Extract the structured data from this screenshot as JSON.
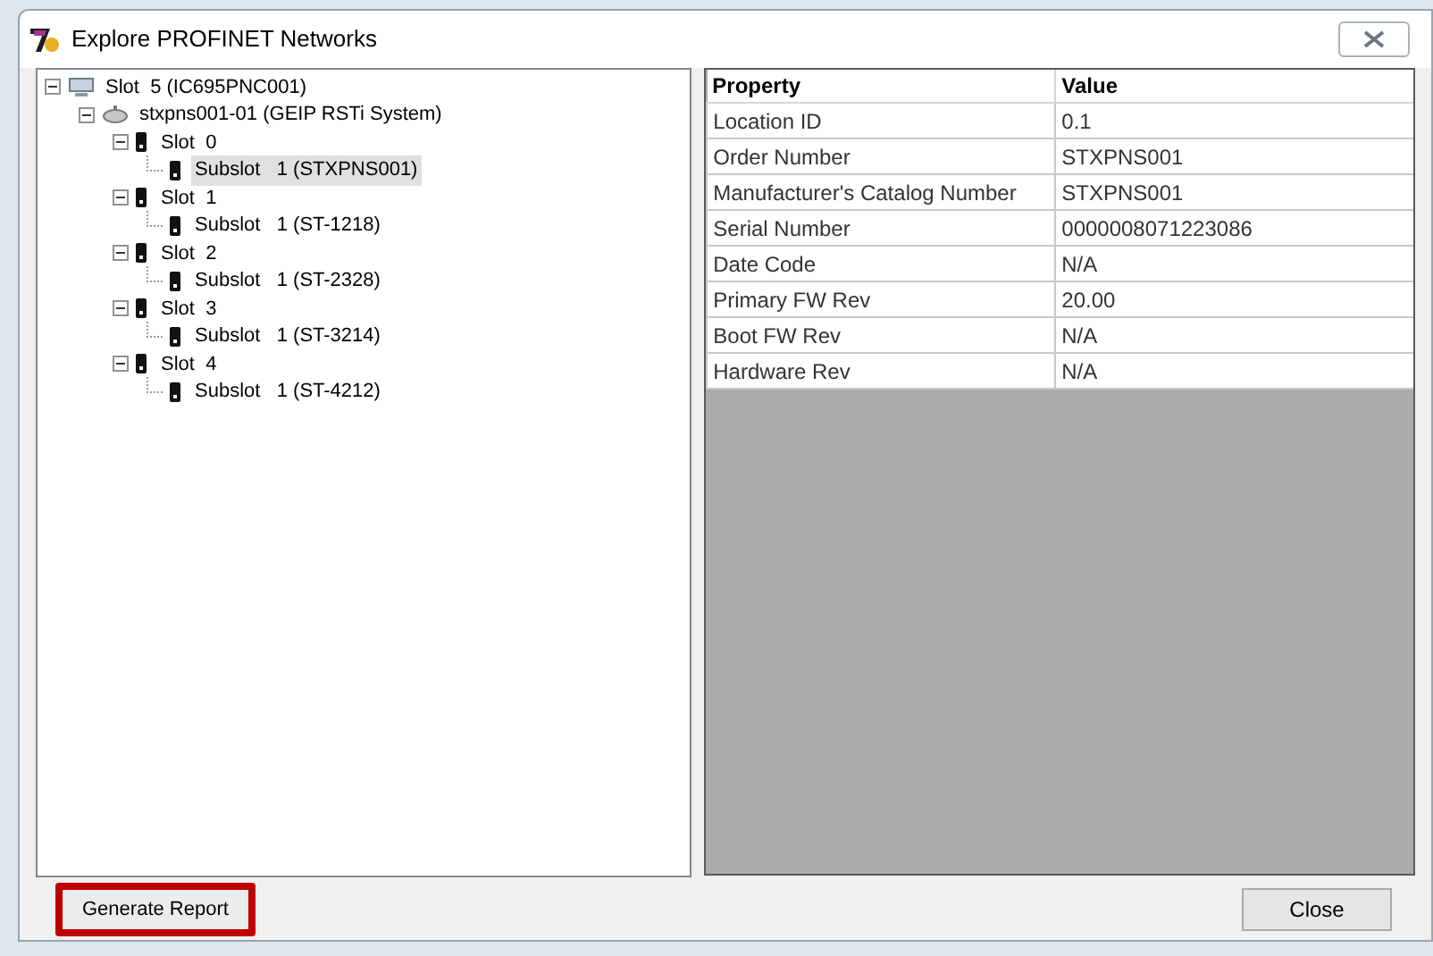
{
  "window": {
    "title": "Explore PROFINET Networks"
  },
  "tree": [
    {
      "label": "Slot  5 (IC695PNC001)",
      "kind": "controller",
      "expanded": true,
      "selected": false,
      "children": [
        {
          "label": "stxpns001-01 (GEIP RSTi System)",
          "kind": "device",
          "expanded": true,
          "selected": false,
          "children": [
            {
              "label": "Slot  0",
              "kind": "module",
              "expanded": true,
              "selected": false,
              "children": [
                {
                  "label": "Subslot   1 (STXPNS001)",
                  "kind": "module",
                  "selected": true
                }
              ]
            },
            {
              "label": "Slot  1",
              "kind": "module",
              "expanded": true,
              "selected": false,
              "children": [
                {
                  "label": "Subslot   1 (ST-1218)",
                  "kind": "module",
                  "selected": false
                }
              ]
            },
            {
              "label": "Slot  2",
              "kind": "module",
              "expanded": true,
              "selected": false,
              "children": [
                {
                  "label": "Subslot   1 (ST-2328)",
                  "kind": "module",
                  "selected": false
                }
              ]
            },
            {
              "label": "Slot  3",
              "kind": "module",
              "expanded": true,
              "selected": false,
              "children": [
                {
                  "label": "Subslot   1 (ST-3214)",
                  "kind": "module",
                  "selected": false
                }
              ]
            },
            {
              "label": "Slot  4",
              "kind": "module",
              "expanded": true,
              "selected": false,
              "children": [
                {
                  "label": "Subslot   1 (ST-4212)",
                  "kind": "module",
                  "selected": false
                }
              ]
            }
          ]
        }
      ]
    }
  ],
  "properties": {
    "columns": [
      "Property",
      "Value"
    ],
    "rows": [
      [
        "Location ID",
        "0.1"
      ],
      [
        "Order Number",
        "STXPNS001"
      ],
      [
        "Manufacturer's Catalog Number",
        "STXPNS001"
      ],
      [
        "Serial Number",
        "0000008071223086"
      ],
      [
        "Date Code",
        "N/A"
      ],
      [
        "Primary FW Rev",
        "20.00"
      ],
      [
        "Boot FW Rev",
        "N/A"
      ],
      [
        "Hardware Rev",
        "N/A"
      ]
    ]
  },
  "buttons": [
    {
      "label": "Generate Report",
      "highlighted": true
    },
    {
      "label": "Close",
      "highlighted": false
    }
  ]
}
